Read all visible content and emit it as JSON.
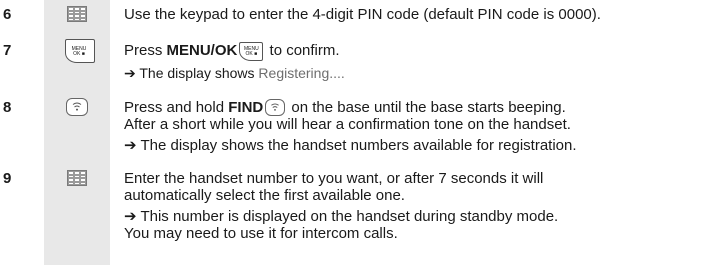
{
  "steps": [
    {
      "number": "6",
      "icon": "keypad-icon",
      "text": "Use the keypad to enter the 4-digit PIN code (default PIN code is 0000)."
    },
    {
      "number": "7",
      "icon": "menu-ok-key-icon",
      "pre": "Press ",
      "bold": "MENU/OK",
      "post": " to confirm.",
      "result_prefix": "➔ The display shows ",
      "result_display": "Registering...."
    },
    {
      "number": "8",
      "icon": "find-key-icon",
      "pre": "Press and hold ",
      "bold": "FIND",
      "post": " on the base until the base starts beeping.",
      "line2": "After a short while you will hear a confirmation tone on the handset.",
      "result": "➔ The display shows the handset numbers available for registration."
    },
    {
      "number": "9",
      "icon": "keypad-icon",
      "line1": "Enter the handset number to you want, or after 7 seconds it will",
      "line2": "automatically select the first available one.",
      "result1": "➔ This number is displayed on the handset during standby mode.",
      "result2": "You may need to use it for intercom calls."
    }
  ],
  "key_labels": {
    "menu_line1": "MENU",
    "menu_line2": "OK ■"
  }
}
